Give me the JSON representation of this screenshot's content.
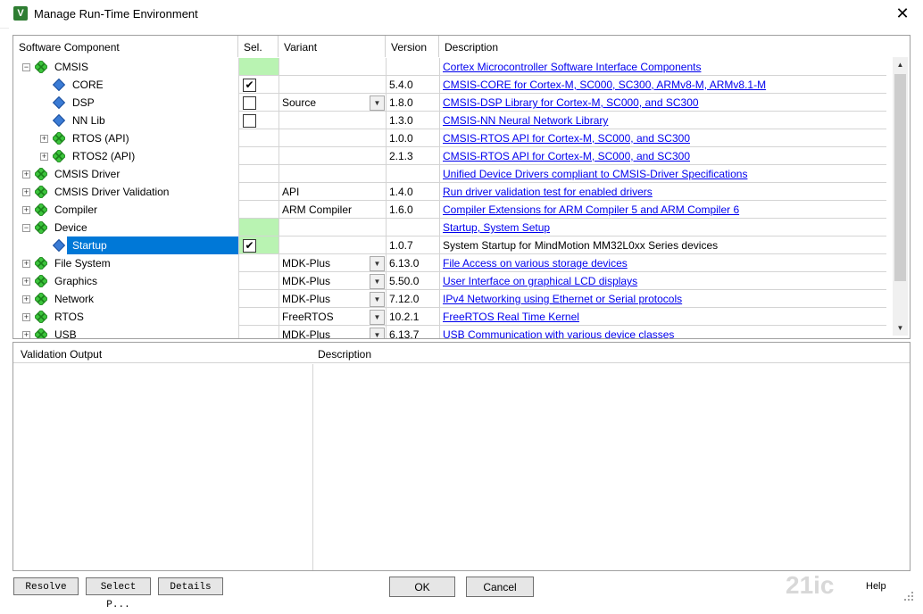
{
  "window": {
    "title": "Manage Run-Time Environment",
    "app_icon": "V",
    "close_label": "✕"
  },
  "table": {
    "headers": {
      "component": "Software Component",
      "sel": "Sel.",
      "variant": "Variant",
      "version": "Version",
      "description": "Description"
    },
    "rows": [
      {
        "name": "CMSIS",
        "level": 0,
        "expand": "minus",
        "icon": "green-gem",
        "sel_green": true,
        "sel": "none",
        "variant": "",
        "dropdown": false,
        "version": "",
        "desc": "Cortex Microcontroller Software Interface Components",
        "link": true
      },
      {
        "name": "CORE",
        "level": 1,
        "expand": "none",
        "icon": "blue-gem",
        "sel_green": false,
        "sel": "checked",
        "variant": "",
        "dropdown": false,
        "version": "5.4.0",
        "desc": "CMSIS-CORE for Cortex-M, SC000, SC300, ARMv8-M, ARMv8.1-M",
        "link": true
      },
      {
        "name": "DSP",
        "level": 1,
        "expand": "none",
        "icon": "blue-gem",
        "sel_green": false,
        "sel": "unchecked",
        "variant": "Source",
        "dropdown": true,
        "version": "1.8.0",
        "desc": "CMSIS-DSP Library for Cortex-M, SC000, and SC300",
        "link": true
      },
      {
        "name": "NN Lib",
        "level": 1,
        "expand": "none",
        "icon": "blue-gem",
        "sel_green": false,
        "sel": "unchecked",
        "variant": "",
        "dropdown": false,
        "version": "1.3.0",
        "desc": "CMSIS-NN Neural Network Library",
        "link": true
      },
      {
        "name": "RTOS (API)",
        "level": 1,
        "expand": "plus",
        "icon": "green-gem",
        "sel_green": false,
        "sel": "none",
        "variant": "",
        "dropdown": false,
        "version": "1.0.0",
        "desc": "CMSIS-RTOS API for Cortex-M, SC000, and SC300",
        "link": true
      },
      {
        "name": "RTOS2 (API)",
        "level": 1,
        "expand": "plus",
        "icon": "green-gem",
        "sel_green": false,
        "sel": "none",
        "variant": "",
        "dropdown": false,
        "version": "2.1.3",
        "desc": "CMSIS-RTOS API for Cortex-M, SC000, and SC300",
        "link": true
      },
      {
        "name": "CMSIS Driver",
        "level": 0,
        "expand": "plus",
        "icon": "green-gem",
        "sel_green": false,
        "sel": "none",
        "variant": "",
        "dropdown": false,
        "version": "",
        "desc": "Unified Device Drivers compliant to CMSIS-Driver Specifications",
        "link": true
      },
      {
        "name": "CMSIS Driver Validation",
        "level": 0,
        "expand": "plus",
        "icon": "green-gem",
        "sel_green": false,
        "sel": "none",
        "variant": "API",
        "dropdown": false,
        "version": "1.4.0",
        "desc": "Run driver validation test for enabled drivers",
        "link": true
      },
      {
        "name": "Compiler",
        "level": 0,
        "expand": "plus",
        "icon": "green-gem",
        "sel_green": false,
        "sel": "none",
        "variant": "ARM Compiler",
        "dropdown": false,
        "version": "1.6.0",
        "desc": "Compiler Extensions for ARM Compiler 5 and ARM Compiler 6",
        "link": true
      },
      {
        "name": "Device",
        "level": 0,
        "expand": "minus",
        "icon": "green-gem",
        "sel_green": true,
        "sel": "none",
        "variant": "",
        "dropdown": false,
        "version": "",
        "desc": "Startup, System Setup",
        "link": true
      },
      {
        "name": "Startup",
        "level": 1,
        "expand": "none",
        "icon": "blue-gem",
        "sel_green": true,
        "sel": "checked",
        "variant": "",
        "dropdown": false,
        "version": "1.0.7",
        "desc": "System Startup for MindMotion MM32L0xx Series devices",
        "link": false,
        "selected": true
      },
      {
        "name": "File System",
        "level": 0,
        "expand": "plus",
        "icon": "green-gem",
        "sel_green": false,
        "sel": "none",
        "variant": "MDK-Plus",
        "dropdown": true,
        "version": "6.13.0",
        "desc": "File Access on various storage devices",
        "link": true
      },
      {
        "name": "Graphics",
        "level": 0,
        "expand": "plus",
        "icon": "green-gem",
        "sel_green": false,
        "sel": "none",
        "variant": "MDK-Plus",
        "dropdown": true,
        "version": "5.50.0",
        "desc": "User Interface on graphical LCD displays",
        "link": true
      },
      {
        "name": "Network",
        "level": 0,
        "expand": "plus",
        "icon": "green-gem",
        "sel_green": false,
        "sel": "none",
        "variant": "MDK-Plus",
        "dropdown": true,
        "version": "7.12.0",
        "desc": "IPv4 Networking using Ethernet or Serial protocols",
        "link": true
      },
      {
        "name": "RTOS",
        "level": 0,
        "expand": "plus",
        "icon": "green-gem",
        "sel_green": false,
        "sel": "none",
        "variant": "FreeRTOS",
        "dropdown": true,
        "version": "10.2.1",
        "desc": "FreeRTOS Real Time Kernel",
        "link": true
      },
      {
        "name": "USB",
        "level": 0,
        "expand": "plus",
        "icon": "green-gem",
        "sel_green": false,
        "sel": "none",
        "variant": "MDK-Plus",
        "dropdown": true,
        "version": "6.13.7",
        "desc": "USB Communication with various device classes",
        "link": true
      }
    ]
  },
  "validation": {
    "output_header": "Validation Output",
    "description_header": "Description"
  },
  "buttons": {
    "resolve": "Resolve",
    "select_packs": "Select P...",
    "details": "Details",
    "ok": "OK",
    "cancel": "Cancel",
    "help": "Help"
  },
  "colors": {
    "selected_row": "#0078d7",
    "green_cell": "#b9f3b2",
    "link": "#0000ee"
  }
}
